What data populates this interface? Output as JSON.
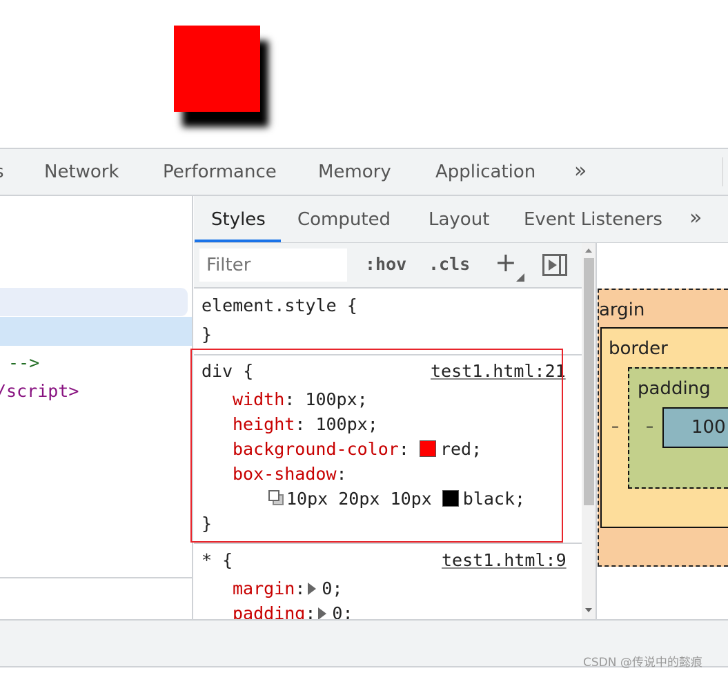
{
  "preview": {
    "box_color": "#ff0000",
    "shadow_color": "#000000"
  },
  "main_tabs": [
    {
      "label": "s"
    },
    {
      "label": "Network"
    },
    {
      "label": "Performance"
    },
    {
      "label": "Memory"
    },
    {
      "label": "Application"
    },
    {
      "label": "»"
    }
  ],
  "elements": {
    "lines": [
      "-->",
      "/script>"
    ]
  },
  "styles_tabs": [
    {
      "label": "Styles",
      "active": true
    },
    {
      "label": "Computed"
    },
    {
      "label": "Layout"
    },
    {
      "label": "Event Listeners"
    },
    {
      "label": "»"
    }
  ],
  "toolbar": {
    "filter_placeholder": "Filter",
    "hov": ":hov",
    "cls": ".cls",
    "plus": "+"
  },
  "rules": {
    "element_style": {
      "selector": "element.style {",
      "close": "}"
    },
    "div": {
      "selector": "div {",
      "source": "test1.html:21",
      "props": [
        {
          "name": "width",
          "value": "100px;"
        },
        {
          "name": "height",
          "value": "100px;"
        },
        {
          "name": "background-color",
          "value": "red;",
          "swatch": "#ff0000"
        },
        {
          "name": "box-shadow",
          "value": "10px 20px 10px",
          "swatch": "#000000",
          "value2": "black;"
        }
      ],
      "close": "}"
    },
    "star": {
      "selector": "* {",
      "source": "test1.html:9",
      "props": [
        {
          "name": "margin",
          "value": "0;"
        },
        {
          "name": "padding",
          "value": "0;"
        }
      ]
    }
  },
  "colon": ":",
  "box_model": {
    "margin": "argin",
    "border": "border",
    "padding": "padding",
    "content": "100",
    "dash": "–",
    "colors": {
      "margin": "#f9cc9d",
      "border": "#fddd9b",
      "padding": "#c3d08b",
      "content": "#8cb6c0"
    }
  },
  "watermark": "CSDN @传说中的懿痕"
}
